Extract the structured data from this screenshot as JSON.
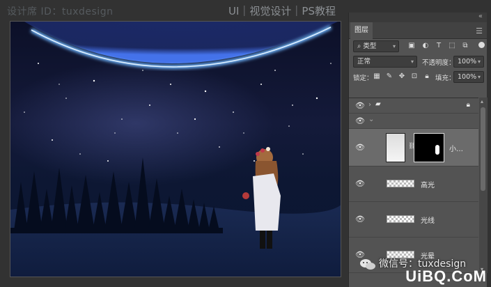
{
  "watermark": {
    "designer_id": "设计席 ID：tuxdesign",
    "site_title": "UI｜视觉设计｜PS教程",
    "wechat": "微信号：tuxdesign",
    "logo": "UiBQ.CoM"
  },
  "panel": {
    "collapse_icon": "collapse-arrows-icon",
    "tab_label": "图层",
    "menu_icon": "panel-menu-icon",
    "filter": {
      "icon": "search-icon",
      "value": "类型"
    },
    "blend_mode": {
      "value": "正常"
    },
    "opacity": {
      "label": "不透明度：",
      "value": "100%"
    },
    "lock": {
      "label": "锁定：",
      "icons": [
        "lock-transparent-icon",
        "lock-paint-icon",
        "lock-move-icon",
        "lock-artboard-icon",
        "lock-all-icon"
      ]
    },
    "fill": {
      "label": "填充：",
      "value": "100%"
    }
  },
  "layers": [
    {
      "name": "",
      "kind": "group-collapsed"
    },
    {
      "name": "",
      "kind": "group-expanded"
    },
    {
      "name": "小…",
      "kind": "image-with-mask"
    },
    {
      "name": "高光",
      "kind": "pixel"
    },
    {
      "name": "光线",
      "kind": "pixel"
    },
    {
      "name": "光晕",
      "kind": "pixel"
    }
  ]
}
